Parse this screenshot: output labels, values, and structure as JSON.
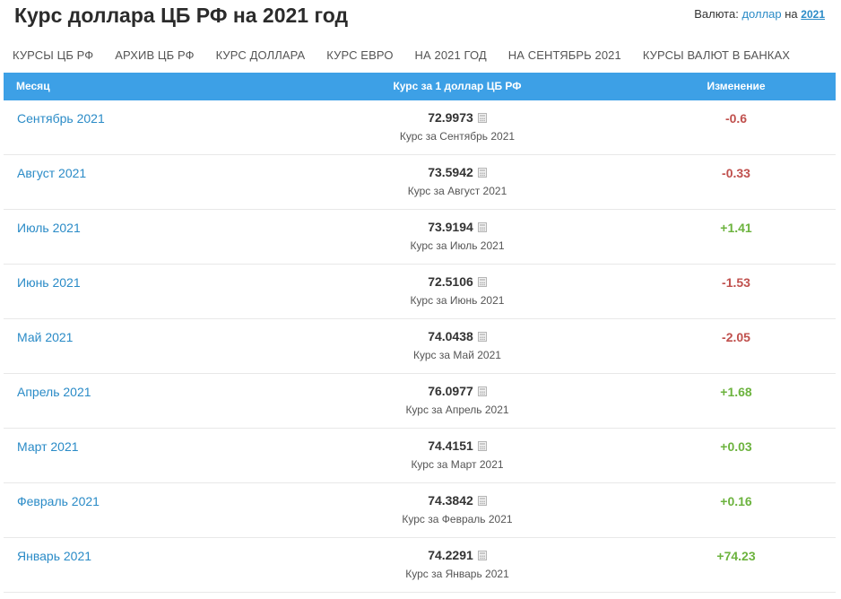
{
  "header": {
    "title": "Курс доллара ЦБ РФ на 2021 год",
    "currency_label": "Валюта:",
    "currency_value": "доллар",
    "year_label": "на",
    "year_value": "2021"
  },
  "nav": [
    "КУРСЫ ЦБ РФ",
    "АРХИВ ЦБ РФ",
    "КУРС ДОЛЛАРА",
    "КУРС ЕВРО",
    "НА 2021 ГОД",
    "НА СЕНТЯБРЬ 2021",
    "КУРСЫ ВАЛЮТ В БАНКАХ"
  ],
  "table": {
    "headers": [
      "Месяц",
      "Курс за 1 доллар ЦБ РФ",
      "Изменение"
    ],
    "rows": [
      {
        "month": "Сентябрь 2021",
        "rate": "72.9973",
        "sub": "Курс за Сентябрь 2021",
        "change": "-0.6"
      },
      {
        "month": "Август 2021",
        "rate": "73.5942",
        "sub": "Курс за Август 2021",
        "change": "-0.33"
      },
      {
        "month": "Июль 2021",
        "rate": "73.9194",
        "sub": "Курс за Июль 2021",
        "change": "+1.41"
      },
      {
        "month": "Июнь 2021",
        "rate": "72.5106",
        "sub": "Курс за Июнь 2021",
        "change": "-1.53"
      },
      {
        "month": "Май 2021",
        "rate": "74.0438",
        "sub": "Курс за Май 2021",
        "change": "-2.05"
      },
      {
        "month": "Апрель 2021",
        "rate": "76.0977",
        "sub": "Курс за Апрель 2021",
        "change": "+1.68"
      },
      {
        "month": "Март 2021",
        "rate": "74.4151",
        "sub": "Курс за Март 2021",
        "change": "+0.03"
      },
      {
        "month": "Февраль 2021",
        "rate": "74.3842",
        "sub": "Курс за Февраль 2021",
        "change": "+0.16"
      },
      {
        "month": "Январь 2021",
        "rate": "74.2291",
        "sub": "Курс за Январь 2021",
        "change": "+74.23"
      }
    ]
  },
  "colors": {
    "header_bg": "#3da0e6",
    "link": "#2a8bc7",
    "negative": "#c0504d",
    "positive": "#6cb33e"
  }
}
